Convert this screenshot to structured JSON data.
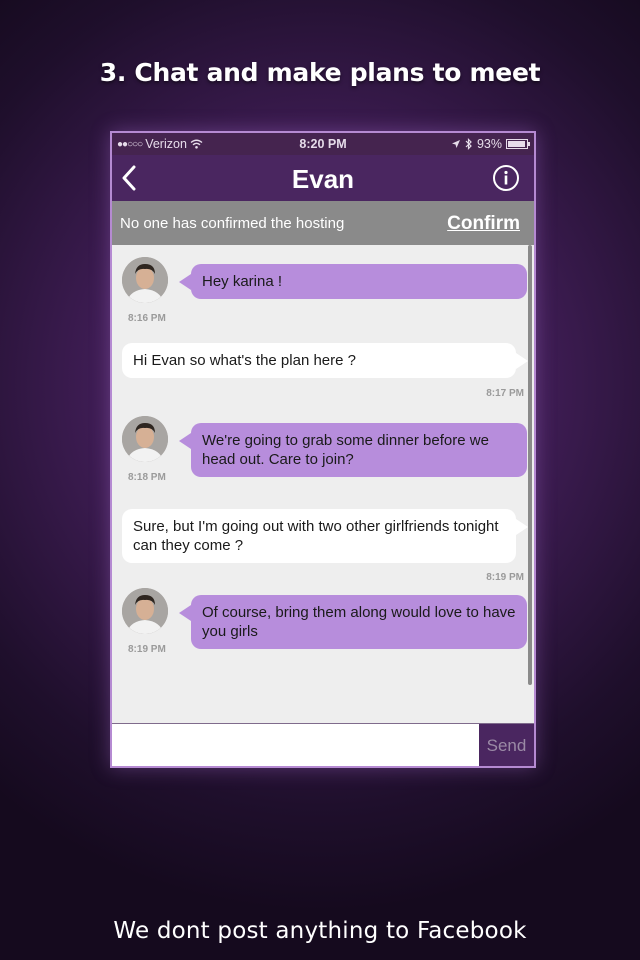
{
  "page": {
    "headline": "3.  Chat and make plans to meet",
    "footer": "We dont post anything to Facebook"
  },
  "status_bar": {
    "carrier": "Verizon",
    "time": "8:20 PM",
    "battery": "93%"
  },
  "nav": {
    "title": "Evan"
  },
  "host_bar": {
    "text": "No one has confirmed the hosting",
    "confirm_label": "Confirm"
  },
  "messages": [
    {
      "direction": "incoming",
      "text": "Hey karina !",
      "time": "8:16 PM"
    },
    {
      "direction": "outgoing",
      "text": "Hi Evan so what's the plan here ?",
      "time": "8:17 PM"
    },
    {
      "direction": "incoming",
      "text": "We're going to grab some dinner before we head out. Care to join?",
      "time": "8:18 PM"
    },
    {
      "direction": "outgoing",
      "text": "Sure, but I'm going out with two other girlfriends tonight can they come ?",
      "time": "8:19 PM"
    },
    {
      "direction": "incoming",
      "text": "Of course, bring them along would love to have you girls",
      "time": "8:19 PM"
    }
  ],
  "composer": {
    "value": "",
    "send_label": "Send"
  },
  "colors": {
    "nav_bg": "#4a2660",
    "incoming_bubble": "#b78ddc",
    "outgoing_bubble": "#ffffff",
    "host_bar_bg": "#8a8a8a"
  },
  "icons": [
    "back-chevron-icon",
    "info-icon",
    "location-arrow-icon",
    "bluetooth-icon",
    "wifi-icon",
    "battery-icon"
  ]
}
